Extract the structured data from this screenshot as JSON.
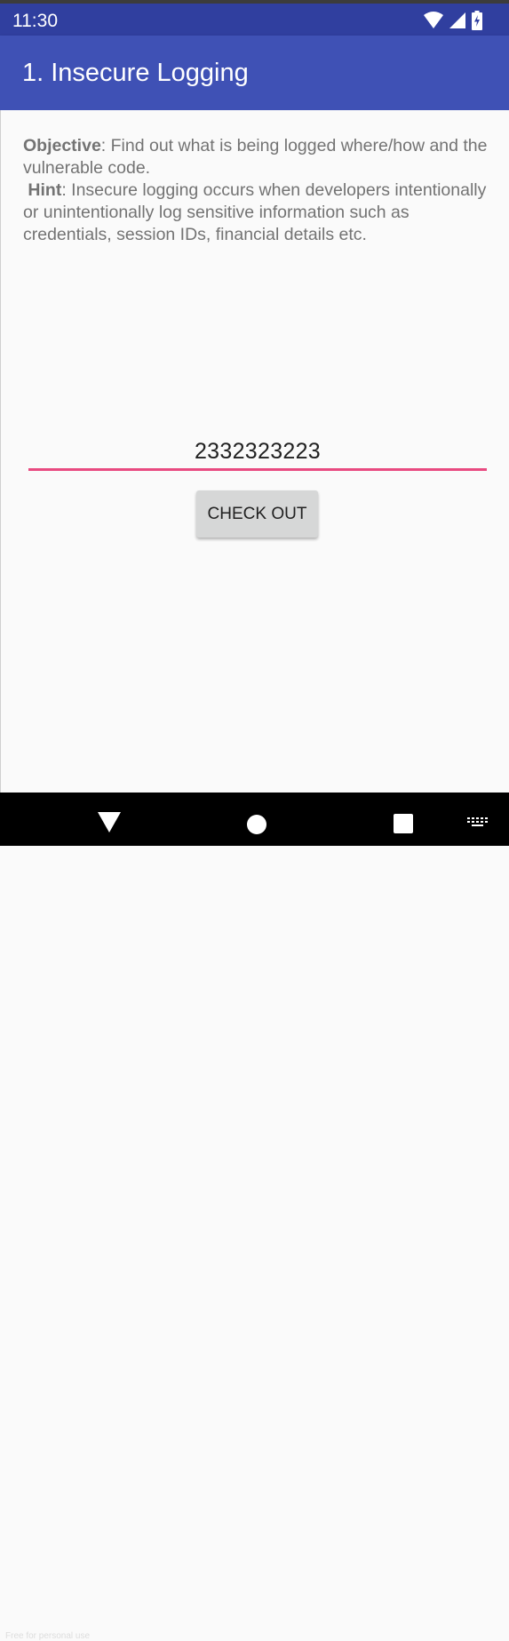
{
  "status_bar": {
    "time": "11:30",
    "icons": [
      "wifi-icon",
      "cellular-signal-icon",
      "battery-charging-icon"
    ]
  },
  "app_bar": {
    "title": "1. Insecure Logging"
  },
  "description": {
    "objective_label": "Objective",
    "objective_text": ": Find out what is being logged where/how and the vulnerable code.",
    "hint_label": "Hint",
    "hint_text": ": Insecure logging occurs when developers intentionally or unintentionally log sensitive information such as credentials, session IDs, financial details etc."
  },
  "input": {
    "value": "2332323223"
  },
  "checkout_button": {
    "label": "CHECK OUT"
  },
  "nav_bar": {
    "icons": [
      "back-icon",
      "home-icon",
      "recents-icon",
      "keyboard-icon"
    ]
  },
  "watermark": "Free for personal use",
  "colors": {
    "status_bar": "#303F9F",
    "app_bar": "#3F51B5",
    "accent": "#E84A80",
    "button": "#D6D7D7",
    "background": "#FAFAFA"
  }
}
